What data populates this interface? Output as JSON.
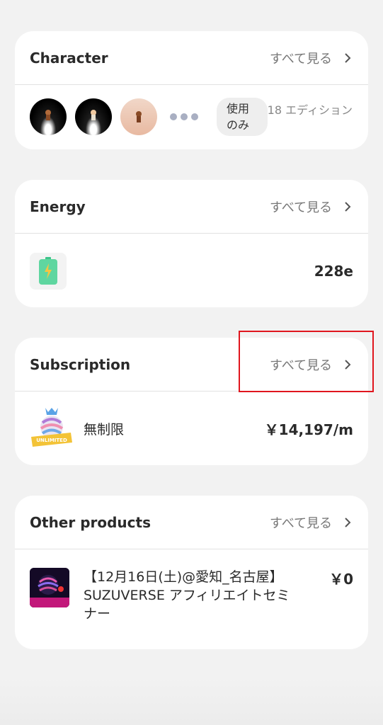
{
  "character": {
    "title": "Character",
    "see_all": "すべて見る",
    "badge": "使用\nのみ",
    "badge_line1": "使用",
    "badge_line2": "のみ",
    "edition": "18 エディション"
  },
  "energy": {
    "title": "Energy",
    "see_all": "すべて見る",
    "value": "228e"
  },
  "subscription": {
    "title": "Subscription",
    "see_all": "すべて見る",
    "plan_name": "無制限",
    "price": "￥14,197/m",
    "logo_label": "UNLIMITED"
  },
  "other": {
    "title": "Other products",
    "see_all": "すべて見る",
    "product_name": "【12月16日(土)@愛知_名古屋】SUZUVERSE アフィリエイトセミナー",
    "price": "￥0"
  },
  "colors": {
    "accent_highlight": "#e0161e",
    "card_bg": "#ffffff",
    "page_bg": "#f2f2f2"
  }
}
